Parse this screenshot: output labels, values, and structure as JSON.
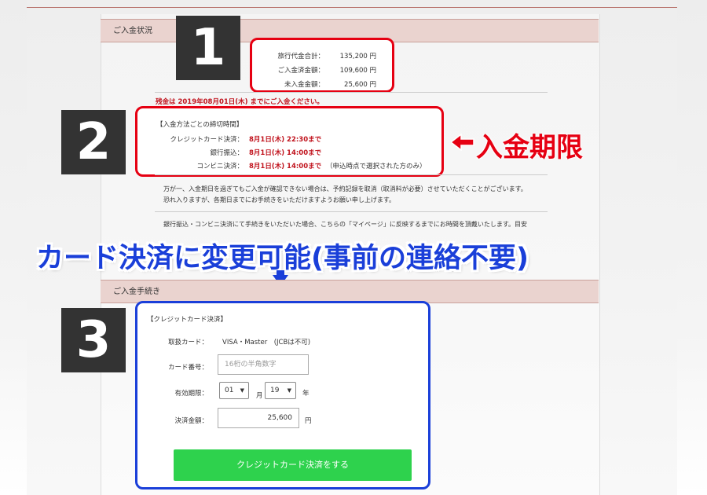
{
  "sections": {
    "status_title": "ご入金状況",
    "procedure_title": "ご入金手続き"
  },
  "badges": [
    "1",
    "2",
    "3"
  ],
  "summary": {
    "rows": [
      {
        "label": "旅行代金合計：",
        "value": "135,200 円"
      },
      {
        "label": "ご入金済金額：",
        "value": "109,600 円"
      },
      {
        "label": "未入金金額：",
        "value": "25,600 円"
      }
    ]
  },
  "deadline_notice": "残金は 2019年08月01日(木) までにご入金ください。",
  "cutoff": {
    "heading": "【入金方法ごとの締切時間】",
    "rows": [
      {
        "label": "クレジットカード決済：",
        "value": "8月1日(木) 22:30まで",
        "note": ""
      },
      {
        "label": "銀行振込：",
        "value": "8月1日(木) 14:00まで",
        "note": ""
      },
      {
        "label": "コンビニ決済：",
        "value": "8月1日(木) 14:00まで",
        "note": "（申込時点で選択された方のみ）"
      }
    ]
  },
  "callouts": {
    "deadline_label": "入金期限",
    "banner": "カード決済に変更可能(事前の連絡不要)"
  },
  "notices": {
    "p1_line1": "万が一、入金期日を過ぎてもご入金が確認できない場合は、予約記録を取消（取消料が必要）させていただくことがございます。",
    "p1_line2": "恐れ入りますが、各期日までにお手続きをいただけますようお願い申し上げます。",
    "p2_line1": "銀行振込・コンビニ決済にて手続きをいただいた場合、こちらの「マイページ」に反映するまでにお時間を頂戴いたします。目安"
  },
  "card_form": {
    "heading": "【クレジットカード決済】",
    "accepted_label": "取扱カード：",
    "accepted_value": "VISA・Master　(JCBは不可)",
    "number_label": "カード番号：",
    "number_placeholder": "16桁の半角数字",
    "expiry_label": "有効期限：",
    "expiry_month": "01",
    "month_unit": "月",
    "expiry_year": "19",
    "year_unit": "年",
    "amount_label": "決済金額：",
    "amount_value": "25,600",
    "amount_unit": "円",
    "submit_label": "クレジットカード決済をする"
  },
  "colors": {
    "highlight_red": "#e60012",
    "highlight_blue": "#1a3fd9",
    "submit_green": "#2ed24d",
    "section_header_bg": "#ead3cf"
  }
}
